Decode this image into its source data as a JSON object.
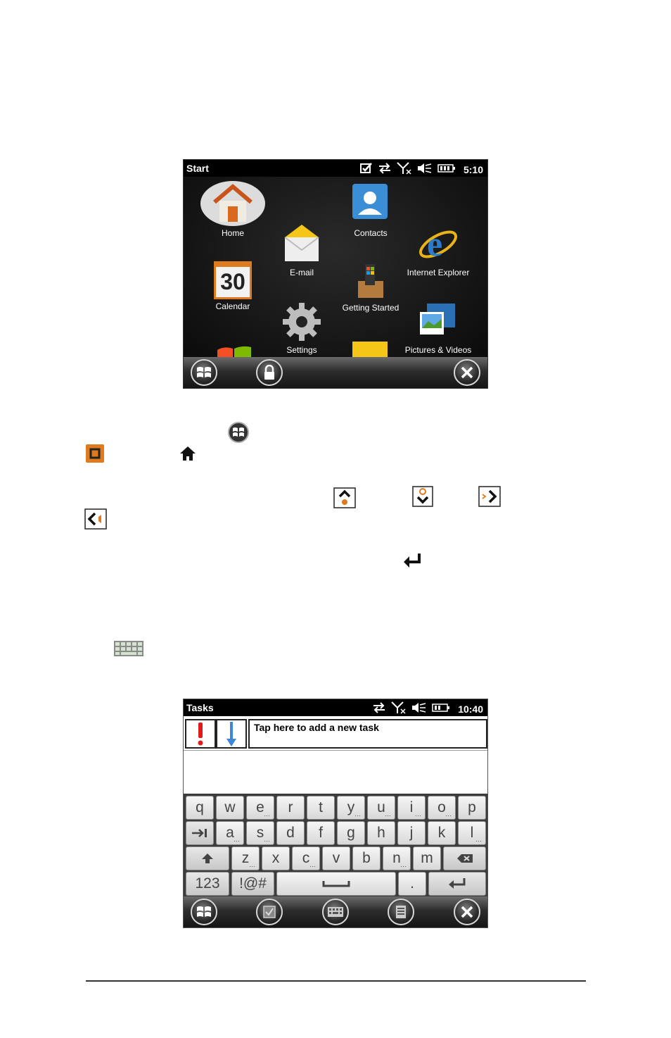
{
  "start_screen": {
    "title": "Start",
    "clock": "5:10",
    "tiles": [
      {
        "label": "Home"
      },
      {
        "label": "Contacts"
      },
      {
        "label": "E-mail"
      },
      {
        "label": "Internet Explorer"
      },
      {
        "label": "Calendar",
        "day": "30"
      },
      {
        "label": "Getting Started"
      },
      {
        "label": "Settings"
      },
      {
        "label": "Pictures & Videos"
      }
    ]
  },
  "tasks_screen": {
    "title": "Tasks",
    "clock": "10:40",
    "new_task_placeholder": "Tap here to add a new task",
    "keyboard": {
      "row1": [
        "q",
        "w",
        "e",
        "r",
        "t",
        "y",
        "u",
        "i",
        "o",
        "p"
      ],
      "row2": [
        "a",
        "s",
        "d",
        "f",
        "g",
        "h",
        "j",
        "k",
        "l"
      ],
      "row3": [
        "z",
        "x",
        "c",
        "v",
        "b",
        "n",
        "m"
      ],
      "row4": {
        "num": "123",
        "sym": "!@#",
        "dot": "."
      }
    }
  },
  "colors": {
    "screen_bg": "#111111",
    "accent_orange": "#e07a1f"
  }
}
